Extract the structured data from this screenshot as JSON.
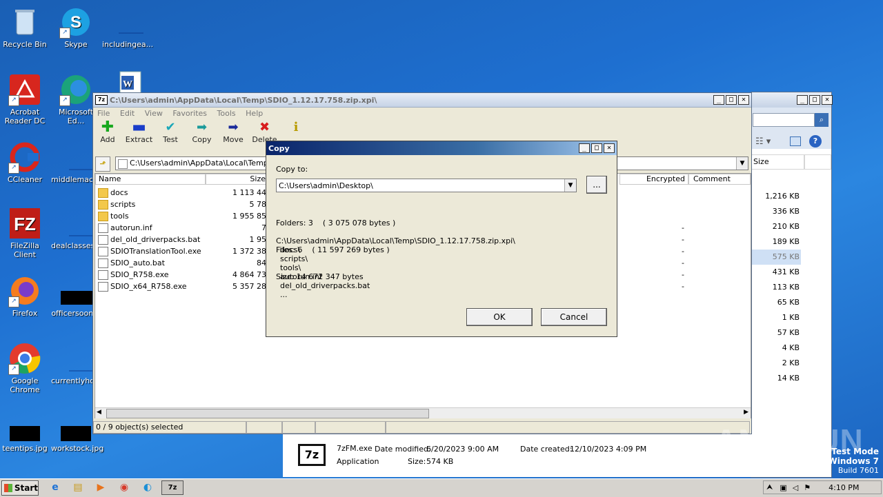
{
  "desktop": {
    "icons": [
      {
        "label": "Recycle Bin"
      },
      {
        "label": "Skype"
      },
      {
        "label": "includingea..."
      },
      {
        "label": "Acrobat Reader DC"
      },
      {
        "label": "Microsoft Ed..."
      },
      {
        "label": "CCleaner"
      },
      {
        "label": "middlemach..."
      },
      {
        "label": "FileZilla Client"
      },
      {
        "label": "dealclasses..."
      },
      {
        "label": "Firefox"
      },
      {
        "label": "officersoon..."
      },
      {
        "label": "Google Chrome"
      },
      {
        "label": "currentlyho..."
      },
      {
        "label": "teentips.jpg"
      },
      {
        "label": "workstock.jpg"
      }
    ]
  },
  "explorer": {
    "sizes": [
      "1,216 KB",
      "336 KB",
      "210 KB",
      "189 KB",
      "575 KB",
      "431 KB",
      "113 KB",
      "65 KB",
      "1 KB",
      "57 KB",
      "4 KB",
      "2 KB",
      "14 KB"
    ],
    "col_size": "Size",
    "details": {
      "name": "7zFM.exe",
      "modified_label": "Date modified:",
      "modified": "6/20/2023 9:00 AM",
      "created_label": "Date created:",
      "created": "12/10/2023 4:09 PM",
      "type": "Application",
      "size_label": "Size:",
      "size": "574 KB",
      "icon_text": "7z"
    }
  },
  "sevenzip": {
    "title": "C:\\Users\\admin\\AppData\\Local\\Temp\\SDIO_1.12.17.758.zip.xpi\\",
    "app_icon": "7z",
    "menu": [
      "File",
      "Edit",
      "View",
      "Favorites",
      "Tools",
      "Help"
    ],
    "toolbar": [
      "Add",
      "Extract",
      "Test",
      "Copy",
      "Move",
      "Delete",
      "Info"
    ],
    "path": "C:\\Users\\admin\\AppData\\Local\\Temp\\SDI",
    "columns": {
      "name": "Name",
      "size": "Size",
      "encrypted": "Encrypted",
      "comment": "Comment"
    },
    "files": [
      {
        "name": "docs",
        "size": "1 113 44",
        "enc": ""
      },
      {
        "name": "scripts",
        "size": "5 78",
        "enc": ""
      },
      {
        "name": "tools",
        "size": "1 955 85",
        "enc": ""
      },
      {
        "name": "autorun.inf",
        "size": "7",
        "enc": "-"
      },
      {
        "name": "del_old_driverpacks.bat",
        "size": "1 95",
        "enc": "-"
      },
      {
        "name": "SDIOTranslationTool.exe",
        "size": "1 372 38",
        "enc": "-"
      },
      {
        "name": "SDIO_auto.bat",
        "size": "84",
        "enc": "-"
      },
      {
        "name": "SDIO_R758.exe",
        "size": "4 864 73",
        "enc": "-"
      },
      {
        "name": "SDIO_x64_R758.exe",
        "size": "5 357 28",
        "enc": "-"
      }
    ],
    "status": "0 / 9 object(s) selected"
  },
  "copy_dialog": {
    "title": "Copy",
    "copy_to_label": "Copy to:",
    "destination": "C:\\Users\\admin\\Desktop\\",
    "browse_label": "...",
    "folders": "Folders: 3    ( 3 075 078 bytes )",
    "files": "Files: 6    ( 11 597 269 bytes )",
    "size": "Size: 14 672 347 bytes",
    "source_path": "C:\\Users\\admin\\AppData\\Local\\Temp\\SDIO_1.12.17.758.zip.xpi\\",
    "items": [
      "docs\\",
      "scripts\\",
      "tools\\",
      "autorun.inf",
      "del_old_driverpacks.bat",
      "..."
    ],
    "ok_label": "OK",
    "cancel_label": "Cancel"
  },
  "taskbar": {
    "start_label": "Start",
    "time": "4:10 PM",
    "active_app": "7z"
  },
  "watermark": {
    "text": "ANY RUN",
    "mode": "Test Mode",
    "os": "Windows 7",
    "build": "Build 7601"
  }
}
